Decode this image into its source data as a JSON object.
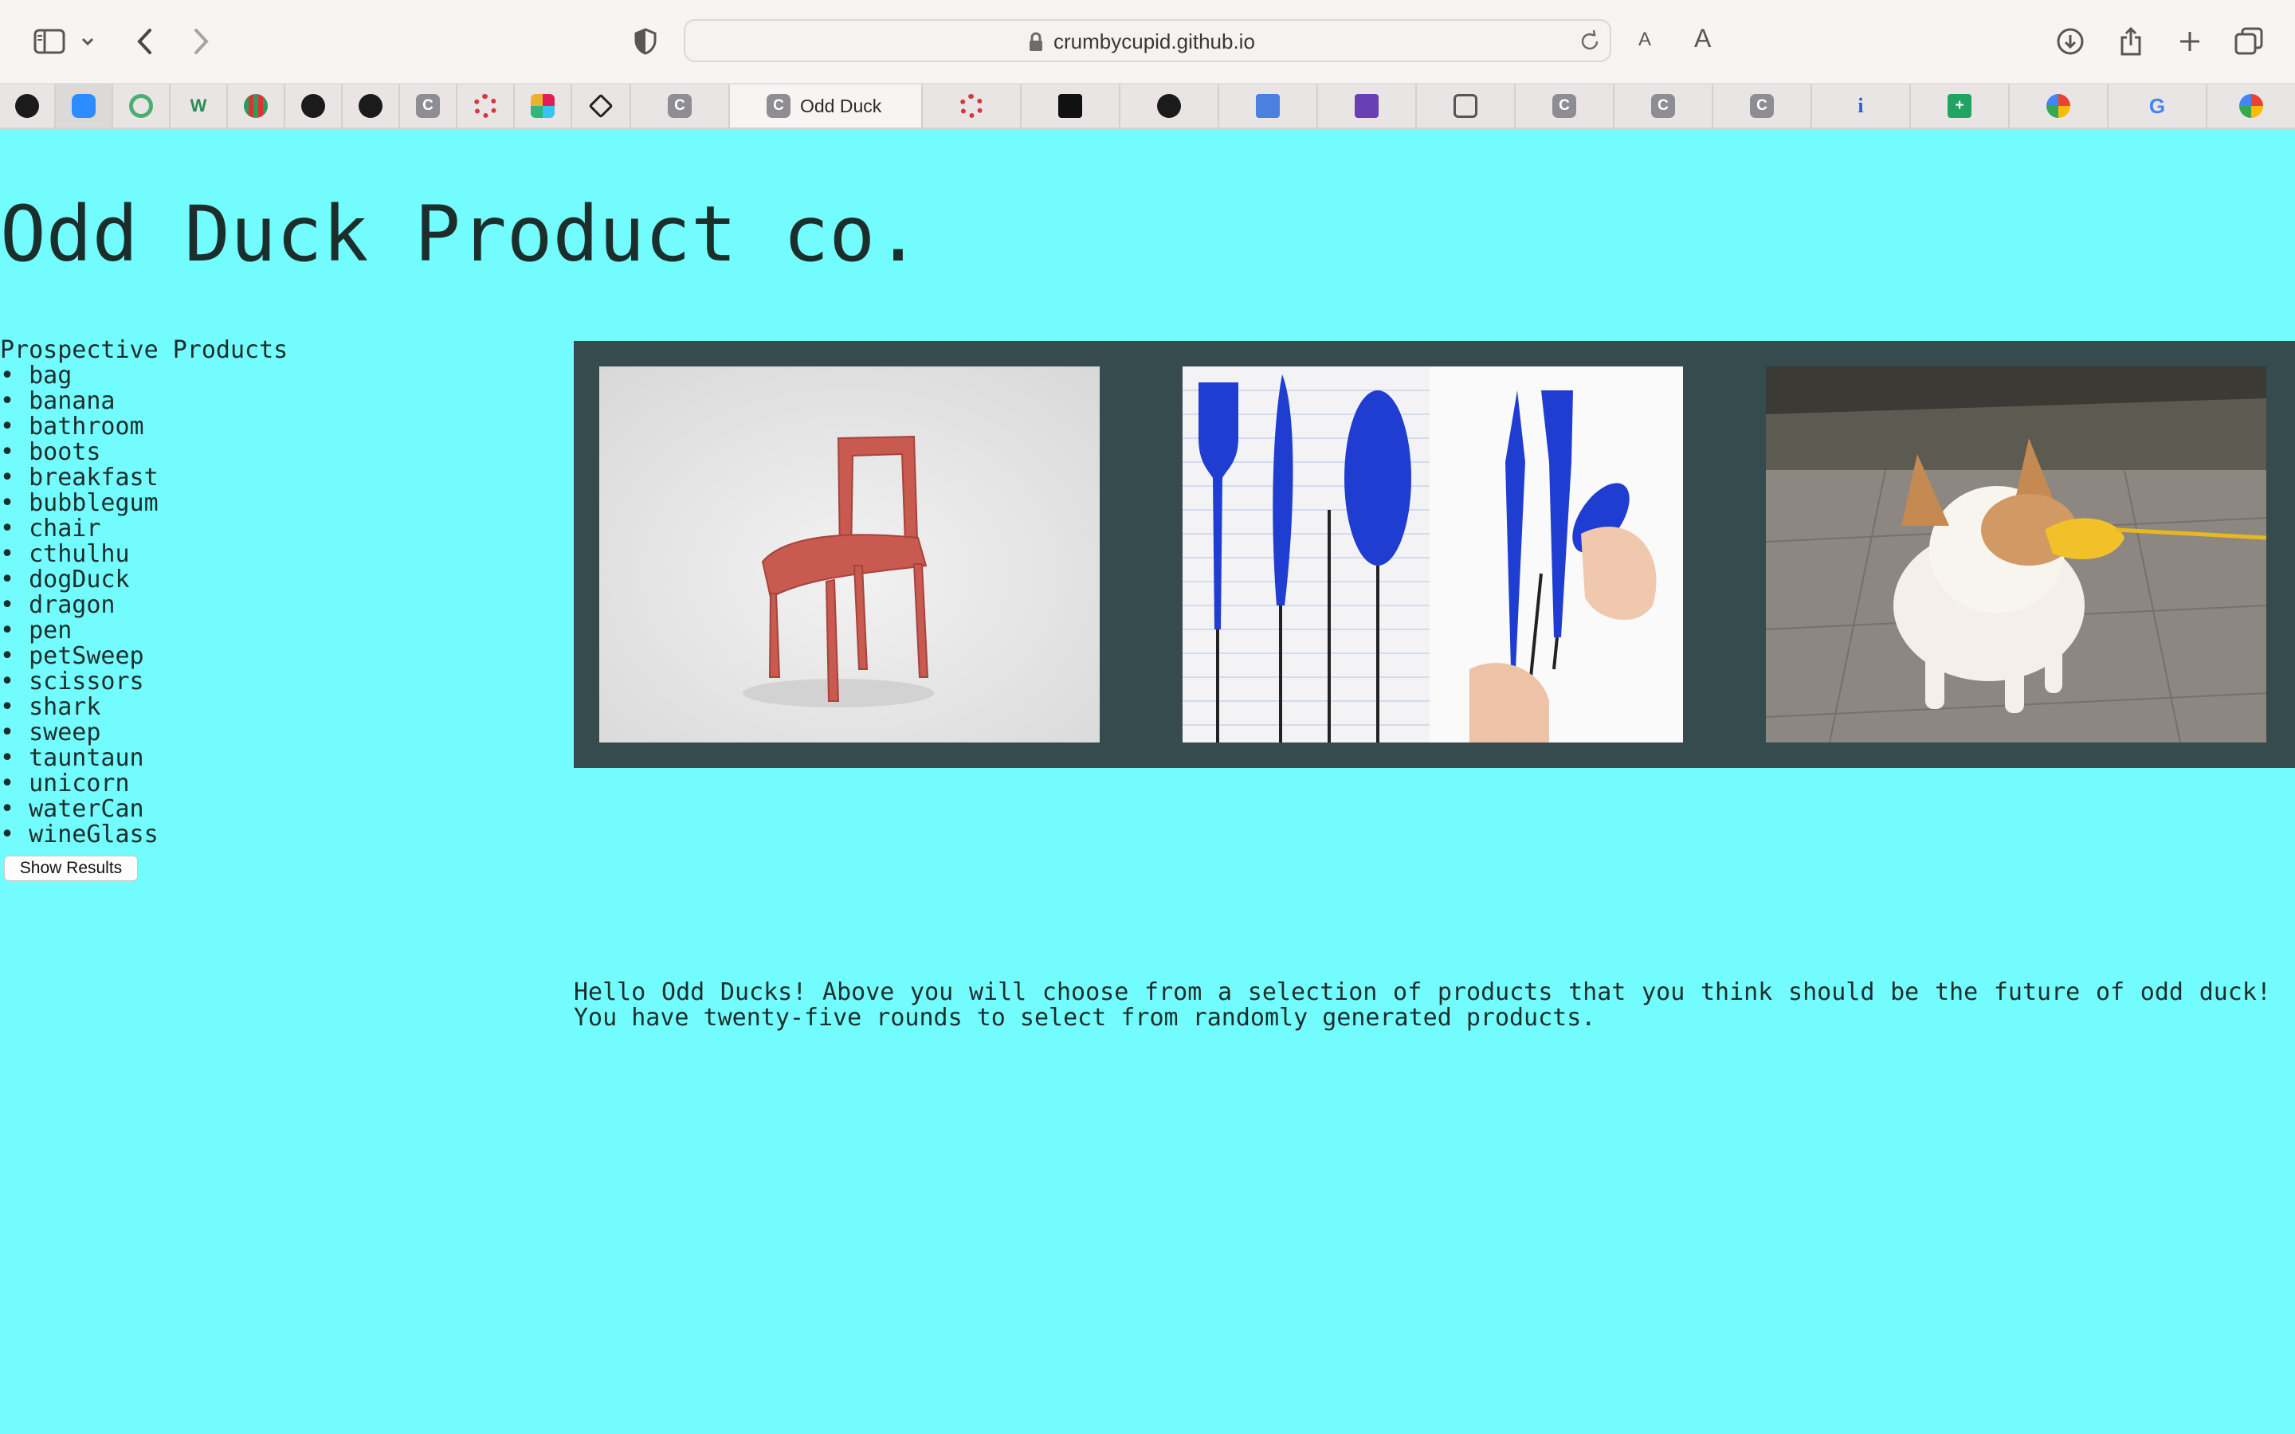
{
  "browser": {
    "url": "crumbycupid.github.io",
    "font_small_label": "A",
    "font_large_label": "A",
    "active_tab_title": "Odd Duck",
    "tab_favicons": [
      "github-icon",
      "zoom-icon",
      "ring-icon",
      "w3-icon",
      "stripe-icon",
      "github-icon",
      "github-icon",
      "c-icon",
      "wheel-icon",
      "slack-icon",
      "diamond-icon",
      "c-icon",
      "c-icon",
      "wheel-icon",
      "medium-icon",
      "github-icon",
      "doc-icon",
      "form-icon",
      "camera-icon",
      "c-icon",
      "c-icon",
      "c-icon",
      "info-icon",
      "sheet-icon",
      "pinwheel-icon",
      "google-icon",
      "pinwheel-icon"
    ]
  },
  "page": {
    "title": "Odd Duck Product co.",
    "sidebar_heading": "Prospective Products",
    "products": [
      "bag",
      "banana",
      "bathroom",
      "boots",
      "breakfast",
      "bubblegum",
      "chair",
      "cthulhu",
      "dogDuck",
      "dragon",
      "pen",
      "petSweep",
      "scissors",
      "shark",
      "sweep",
      "tauntaun",
      "unicorn",
      "waterCan",
      "wineGlass"
    ],
    "show_results_label": "Show Results",
    "images": [
      "chair",
      "pen",
      "dogDuck"
    ],
    "intro_text": "Hello Odd Ducks! Above you will choose from a selection of products that you think should be the future of odd duck! You have twenty-five rounds to select from randomly generated products.",
    "colors": {
      "background": "#73fcfd",
      "panel": "#364b4d",
      "text": "#1c2e2c"
    }
  }
}
